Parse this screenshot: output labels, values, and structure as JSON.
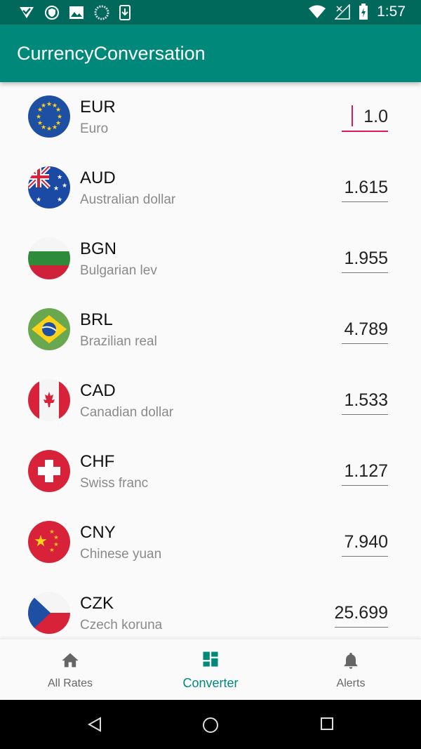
{
  "status": {
    "time": "1:57"
  },
  "app": {
    "title": "CurrencyConversation"
  },
  "currencies": [
    {
      "code": "EUR",
      "name": "Euro",
      "value": "1.0",
      "flag": "eu-flag-icon"
    },
    {
      "code": "AUD",
      "name": "Australian dollar",
      "value": "1.615",
      "flag": "australia-flag-icon"
    },
    {
      "code": "BGN",
      "name": "Bulgarian lev",
      "value": "1.955",
      "flag": "bulgaria-flag-icon"
    },
    {
      "code": "BRL",
      "name": "Brazilian real",
      "value": "4.789",
      "flag": "brazil-flag-icon"
    },
    {
      "code": "CAD",
      "name": "Canadian dollar",
      "value": "1.533",
      "flag": "canada-flag-icon"
    },
    {
      "code": "CHF",
      "name": "Swiss franc",
      "value": "1.127",
      "flag": "switzerland-flag-icon"
    },
    {
      "code": "CNY",
      "name": "Chinese yuan",
      "value": "7.940",
      "flag": "china-flag-icon"
    },
    {
      "code": "CZK",
      "name": "Czech koruna",
      "value": "25.699",
      "flag": "czech-flag-icon"
    }
  ],
  "nav": {
    "items": [
      {
        "label": "All Rates",
        "icon": "home-icon"
      },
      {
        "label": "Converter",
        "icon": "dashboard-icon",
        "active": true
      },
      {
        "label": "Alerts",
        "icon": "bell-icon"
      }
    ]
  },
  "colors": {
    "primary": "#00897b",
    "primary_dark": "#00695c",
    "accent": "#d81b60"
  }
}
